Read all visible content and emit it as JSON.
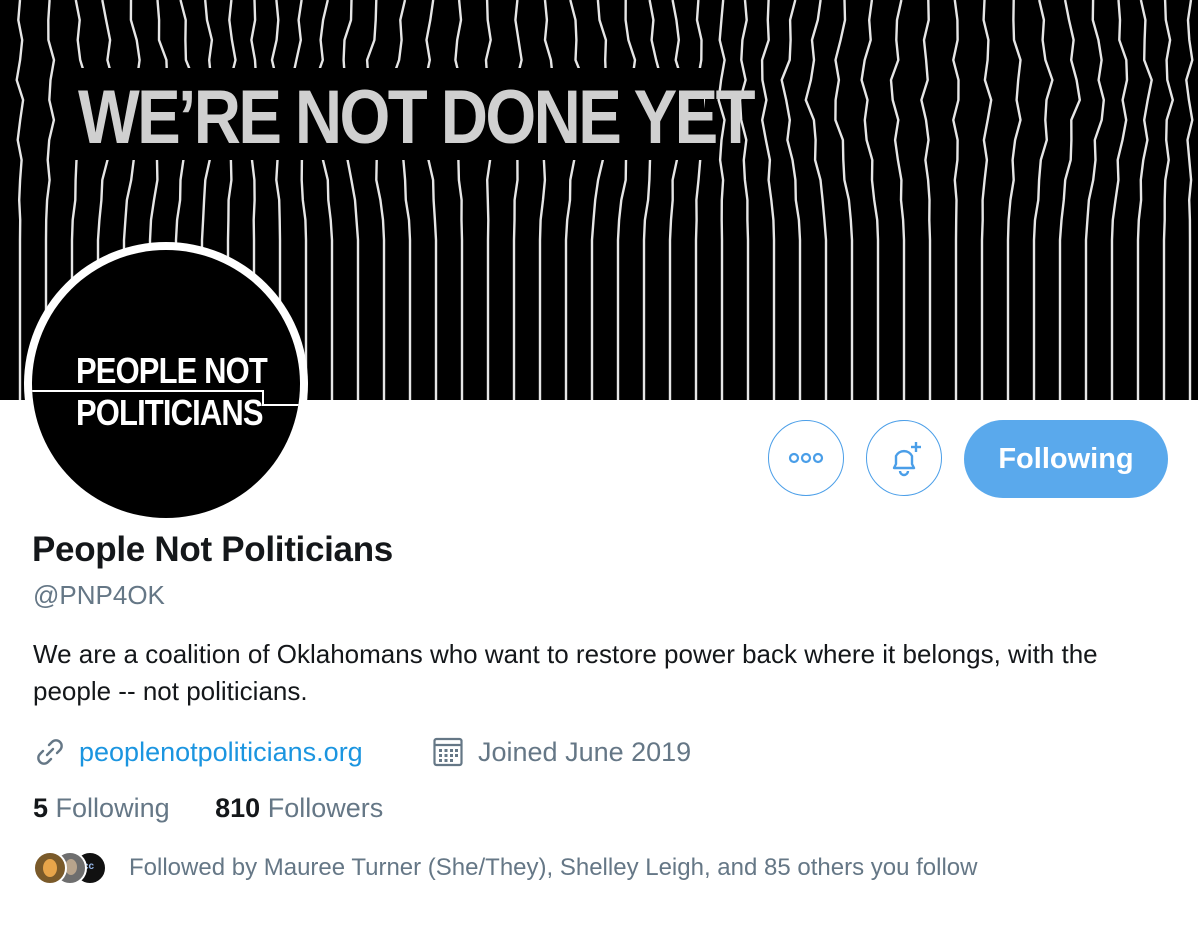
{
  "banner": {
    "headline": "WE’RE NOT DONE YET"
  },
  "avatar": {
    "line1": "PEOPLE NOT",
    "line2": "POLITICIANS"
  },
  "actions": {
    "more_icon": "more-dots-icon",
    "notify_icon": "bell-plus-icon",
    "follow_label": "Following",
    "accent": "#5aa9ec"
  },
  "profile": {
    "name": "People Not Politicians",
    "handle": "@PNP4OK",
    "bio": "We are a coalition of Oklahomans who want to restore power back where it belongs, with the people -- not politicians.",
    "website": "peoplenotpoliticians.org",
    "joined": "Joined June 2019"
  },
  "stats": {
    "following_count": "5",
    "following_label": "Following",
    "followers_count": "810",
    "followers_label": "Followers"
  },
  "followed_by": {
    "text": "Followed by Mauree Turner (She/They), Shelley Leigh, and 85 others you follow",
    "avatars": [
      "follower-avatar-1",
      "follower-avatar-2",
      "follower-avatar-3"
    ]
  },
  "colors": {
    "link": "#1b95e0",
    "muted": "#657786",
    "text": "#14171a"
  }
}
